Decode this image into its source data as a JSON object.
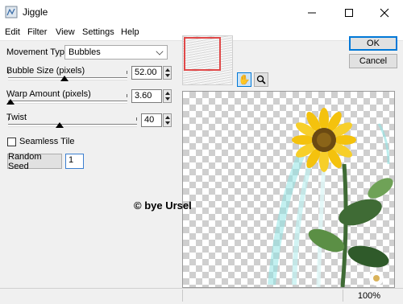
{
  "window": {
    "title": "Jiggle",
    "minimize_icon": "minimize-icon",
    "maximize_icon": "maximize-icon",
    "close_icon": "close-icon"
  },
  "menu": {
    "items": [
      "Edit",
      "Filter",
      "View",
      "Settings",
      "Help"
    ]
  },
  "controls": {
    "movement_type": {
      "label": "Movement Type:",
      "value": "Bubbles"
    },
    "bubble_size": {
      "label": "Bubble Size (pixels)",
      "value": "52.00",
      "slider_fraction": 0.47
    },
    "warp_amount": {
      "label": "Warp Amount (pixels)",
      "value": "3.60",
      "slider_fraction": 0.02
    },
    "twist": {
      "label": "Twist",
      "value": "40",
      "slider_fraction": 0.4
    },
    "seamless_tile": {
      "label": "Seamless Tile",
      "checked": false
    },
    "random_seed": {
      "label": "Random Seed",
      "value": "1"
    }
  },
  "buttons": {
    "ok": "OK",
    "cancel": "Cancel"
  },
  "tools": {
    "hand": "hand-icon",
    "zoom": "magnifier-icon"
  },
  "canvas": {
    "watermark": "© bye Ursel"
  },
  "status": {
    "zoom": "100%"
  },
  "colors": {
    "preview_rect": "#e04848",
    "default_button_border": "#0078d7",
    "sunflower_petal": "#f4c20d",
    "leaf": "#3f6b35",
    "streak": "#8fe3e3"
  }
}
